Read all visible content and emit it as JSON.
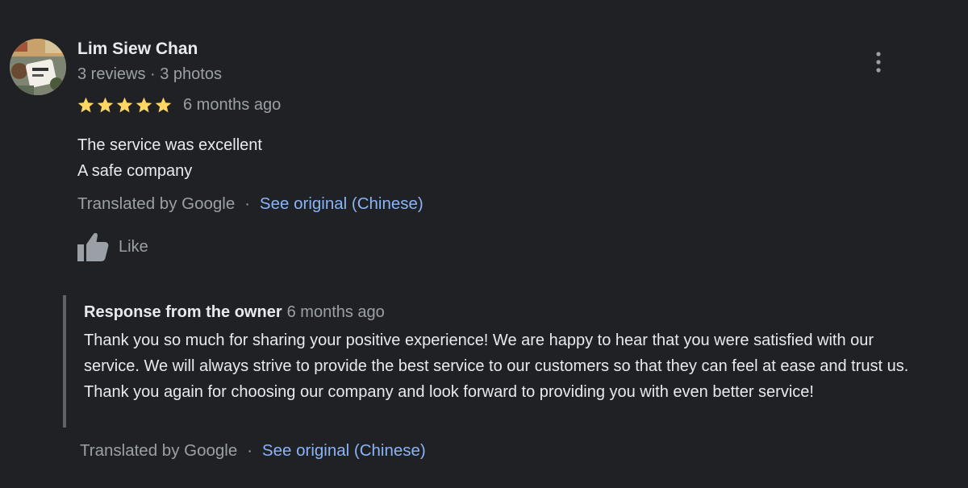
{
  "review": {
    "author_name": "Lim Siew Chan",
    "author_meta": "3 reviews · 3 photos",
    "rating": 5,
    "rating_max": 5,
    "star_color": "#fdd663",
    "time": "6 months ago",
    "text_lines": [
      "The service was excellent",
      "A safe company"
    ],
    "translated_label": "Translated by Google",
    "separator": "·",
    "see_original": "See original (Chinese)",
    "like_label": "Like",
    "more_icon": "vertical-dots-icon"
  },
  "owner_response": {
    "title": "Response from the owner",
    "time": "6 months ago",
    "text": "Thank you so much for sharing your positive experience! We are happy to hear that you were satisfied with our service. We will always strive to provide the best service to our customers so that they can feel at ease and trust us. Thank you again for choosing our company and look forward to providing you with even better service!",
    "translated_label": "Translated by Google",
    "separator": "·",
    "see_original": "See original (Chinese)"
  },
  "colors": {
    "background": "#202124",
    "primary_text": "#e8eaed",
    "secondary_text": "#9aa0a6",
    "link": "#8ab4f8",
    "response_border": "#5f6368"
  }
}
